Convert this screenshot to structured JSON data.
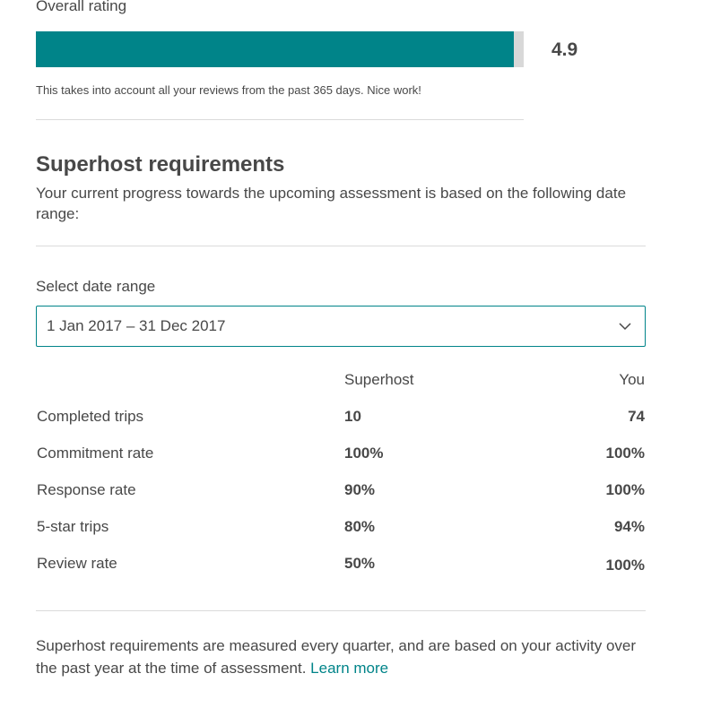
{
  "overall_rating": {
    "label": "Overall rating",
    "value": "4.9",
    "max": 5,
    "fill_fraction": 0.98,
    "note": "This takes into account all your reviews from the past 365 days. Nice work!",
    "bar_color": "#008489",
    "track_color": "#d8d8d8"
  },
  "superhost": {
    "title": "Superhost requirements",
    "subtitle": "Your current progress towards the upcoming assessment is based on the following date range:",
    "select_label": "Select date range",
    "selected_range": "1 Jan 2017 – 31 Dec 2017",
    "columns": {
      "superhost": "Superhost",
      "you": "You"
    },
    "rows": [
      {
        "metric": "Completed trips",
        "superhost": "10",
        "you": "74"
      },
      {
        "metric": "Commitment rate",
        "superhost": "100%",
        "you": "100%"
      },
      {
        "metric": "Response rate",
        "superhost": "90%",
        "you": "100%"
      },
      {
        "metric": "5-star trips",
        "superhost": "80%",
        "you": "94%"
      },
      {
        "metric": "Review rate",
        "superhost": "50%",
        "you": "100%"
      }
    ],
    "footer_text": "Superhost requirements are measured every quarter, and are based on your activity over the past year at the time of assessment.",
    "learn_more": "Learn more",
    "accent_color": "#008489"
  }
}
